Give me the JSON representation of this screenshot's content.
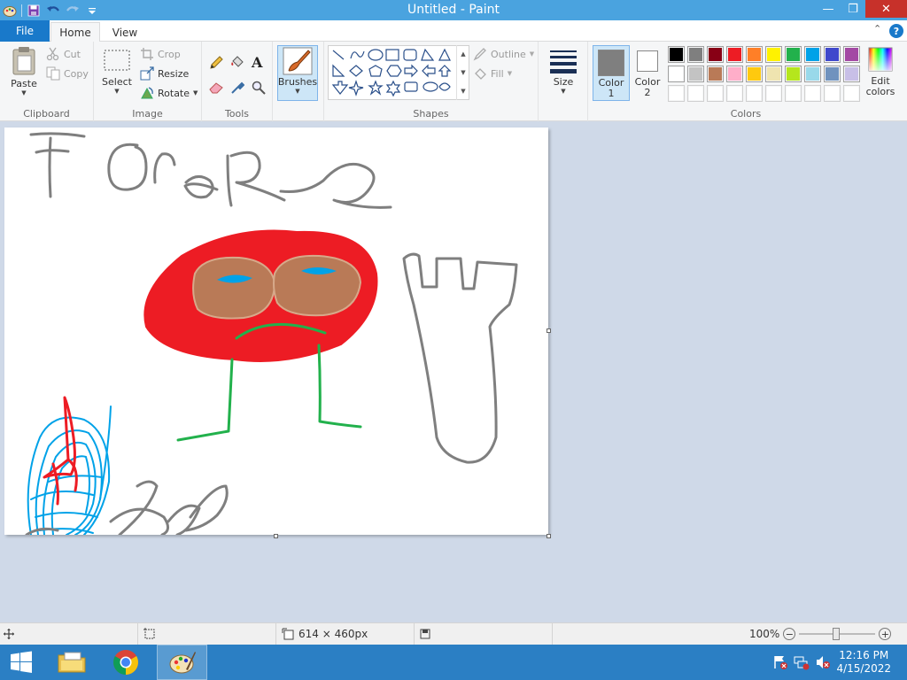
{
  "window": {
    "title": "Untitled - Paint",
    "controls": {
      "minimize": "—",
      "restore": "❐",
      "close": "✕"
    }
  },
  "tabs": {
    "file": "File",
    "home": "Home",
    "view": "View",
    "help": "?"
  },
  "ribbon": {
    "clipboard": {
      "paste": "Paste",
      "cut": "Cut",
      "copy": "Copy",
      "label": "Clipboard"
    },
    "image": {
      "select": "Select",
      "crop": "Crop",
      "resize": "Resize",
      "rotate": "Rotate",
      "label": "Image"
    },
    "tools": {
      "text_tool": "A",
      "label": "Tools"
    },
    "brushes": {
      "label": "Brushes"
    },
    "shapes": {
      "outline": "Outline",
      "fill": "Fill",
      "label": "Shapes"
    },
    "size": {
      "label": "Size"
    },
    "colors": {
      "color1_label_1": "Color",
      "color1_label_2": "1",
      "color2_label_1": "Color",
      "color2_label_2": "2",
      "edit_label_1": "Edit",
      "edit_label_2": "colors",
      "label": "Colors",
      "color1": "#7f7f7f",
      "color2": "#ffffff",
      "palette_row1": [
        "#000000",
        "#7f7f7f",
        "#880015",
        "#ed1c24",
        "#ff7f27",
        "#fff200",
        "#22b14c",
        "#00a2e8",
        "#3f48cc",
        "#a349a4"
      ],
      "palette_row2": [
        "#ffffff",
        "#c3c3c3",
        "#b97a57",
        "#ffaec9",
        "#ffc90e",
        "#efe4b0",
        "#b5e61d",
        "#99d9ea",
        "#7092be",
        "#c8bfe7"
      ],
      "palette_row3": [
        "#ffffff",
        "#ffffff",
        "#ffffff",
        "#ffffff",
        "#ffffff",
        "#ffffff",
        "#ffffff",
        "#ffffff",
        "#ffffff",
        "#ffffff"
      ]
    }
  },
  "status": {
    "canvas_size": "614 × 460px",
    "zoom": "100%",
    "zoom_out": "−",
    "zoom_in": "+"
  },
  "taskbar": {
    "time": "12:16 PM",
    "date": "4/15/2022"
  }
}
